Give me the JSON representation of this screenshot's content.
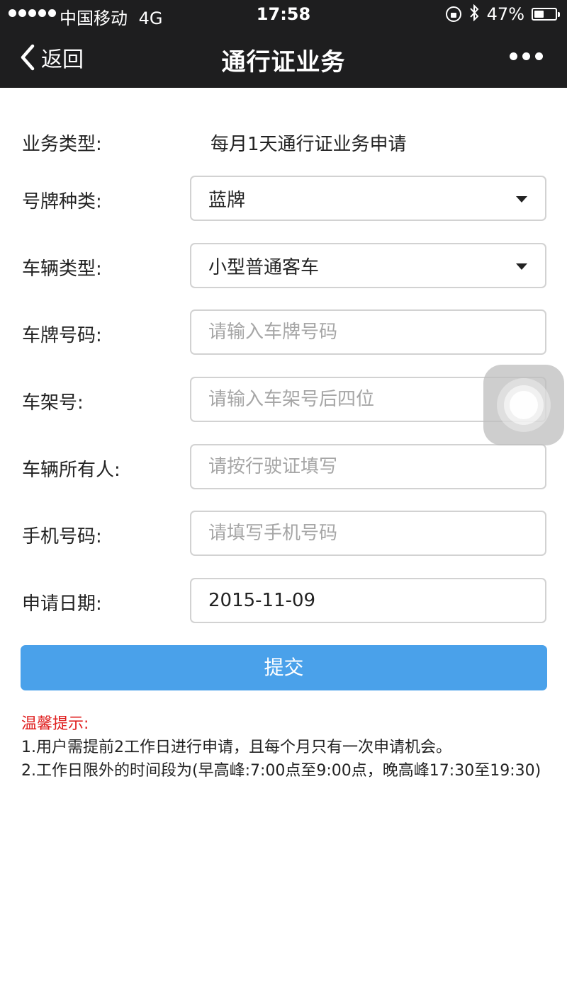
{
  "status_bar": {
    "carrier": "中国移动",
    "network": "4G",
    "time": "17:58",
    "battery": "47%",
    "battery_level": 0.47
  },
  "nav": {
    "back_label": "返回",
    "title": "通行证业务"
  },
  "form": {
    "business_type": {
      "label": "业务类型:",
      "value": "每月1天通行证业务申请"
    },
    "plate_kind": {
      "label": "号牌种类:",
      "value": "蓝牌"
    },
    "vehicle_type": {
      "label": "车辆类型:",
      "value": "小型普通客车"
    },
    "plate_number": {
      "label": "车牌号码:",
      "placeholder": "请输入车牌号码"
    },
    "frame_number": {
      "label": "车架号:",
      "placeholder": "请输入车架号后四位"
    },
    "owner": {
      "label": "车辆所有人:",
      "placeholder": "请按行驶证填写"
    },
    "phone": {
      "label": "手机号码:",
      "placeholder": "请填写手机号码"
    },
    "apply_date": {
      "label": "申请日期:",
      "value": "2015-11-09"
    },
    "submit_label": "提交"
  },
  "tips": {
    "title": "温馨提示:",
    "lines": [
      "1.用户需提前2工作日进行申请，且每个月只有一次申请机会。",
      "2.工作日限外的时间段为(早高峰:7:00点至9:00点，晚高峰17:30至19:30)"
    ]
  }
}
